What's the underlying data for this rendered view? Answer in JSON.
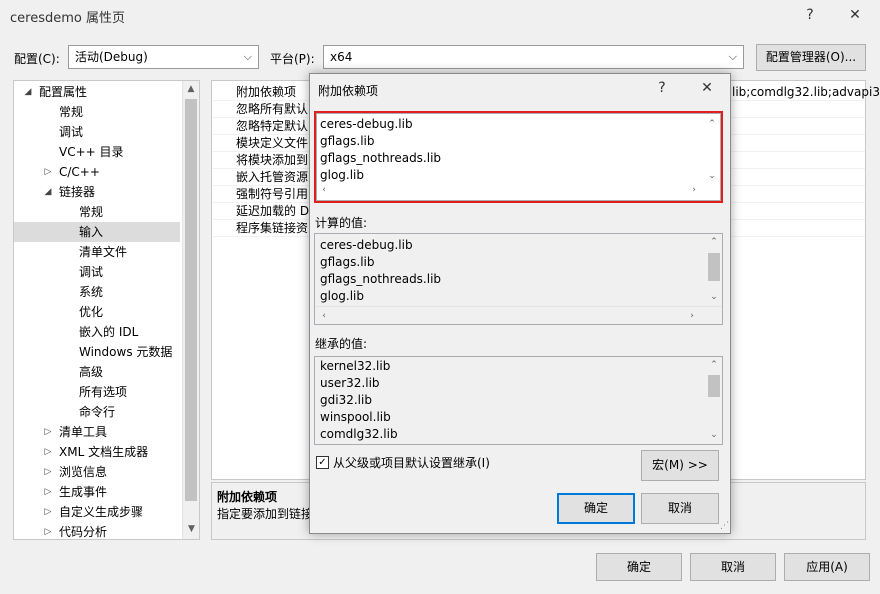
{
  "window": {
    "title": "ceresdemo 属性页",
    "help_glyph": "?",
    "close_glyph": "✕"
  },
  "toolbar": {
    "config_label": "配置(C):",
    "config_value": "活动(Debug)",
    "platform_label": "平台(P):",
    "platform_value": "x64",
    "config_manager_label": "配置管理器(O)..."
  },
  "tree": {
    "items": [
      {
        "label": "配置属性",
        "toggle": "◢"
      },
      {
        "label": "常规",
        "toggle": ""
      },
      {
        "label": "调试",
        "toggle": ""
      },
      {
        "label": "VC++ 目录",
        "toggle": ""
      },
      {
        "label": "C/C++",
        "toggle": "▷"
      },
      {
        "label": "链接器",
        "toggle": "◢"
      },
      {
        "label": "常规",
        "toggle": ""
      },
      {
        "label": "输入",
        "toggle": ""
      },
      {
        "label": "清单文件",
        "toggle": ""
      },
      {
        "label": "调试",
        "toggle": ""
      },
      {
        "label": "系统",
        "toggle": ""
      },
      {
        "label": "优化",
        "toggle": ""
      },
      {
        "label": "嵌入的 IDL",
        "toggle": ""
      },
      {
        "label": "Windows 元数据",
        "toggle": ""
      },
      {
        "label": "高级",
        "toggle": ""
      },
      {
        "label": "所有选项",
        "toggle": ""
      },
      {
        "label": "命令行",
        "toggle": ""
      },
      {
        "label": "清单工具",
        "toggle": "▷"
      },
      {
        "label": "XML 文档生成器",
        "toggle": "▷"
      },
      {
        "label": "浏览信息",
        "toggle": "▷"
      },
      {
        "label": "生成事件",
        "toggle": "▷"
      },
      {
        "label": "自定义生成步骤",
        "toggle": "▷"
      },
      {
        "label": "代码分析",
        "toggle": "▷"
      }
    ]
  },
  "grid": {
    "rows": [
      {
        "name": "附加依赖项",
        "value": "lib;comdlg32.lib;advapi3"
      },
      {
        "name": "忽略所有默认",
        "value": ""
      },
      {
        "name": "忽略特定默认",
        "value": ""
      },
      {
        "name": "模块定义文件",
        "value": ""
      },
      {
        "name": "将模块添加到",
        "value": ""
      },
      {
        "name": "嵌入托管资源",
        "value": ""
      },
      {
        "name": "强制符号引用",
        "value": ""
      },
      {
        "name": "延迟加载的 D",
        "value": ""
      },
      {
        "name": "程序集链接资",
        "value": ""
      }
    ],
    "desc_title": "附加依赖项",
    "desc_text": "指定要添加到链接"
  },
  "dialog": {
    "title": "附加依赖项",
    "help_glyph": "?",
    "close_glyph": "✕",
    "edit_lines": [
      "ceres-debug.lib",
      "gflags.lib",
      "gflags_nothreads.lib",
      "glog.lib"
    ],
    "computed_label": "计算的值:",
    "computed_lines": [
      "ceres-debug.lib",
      "gflags.lib",
      "gflags_nothreads.lib",
      "glog.lib"
    ],
    "inherited_label": "继承的值:",
    "inherited_lines": [
      "kernel32.lib",
      "user32.lib",
      "gdi32.lib",
      "winspool.lib",
      "comdlg32.lib"
    ],
    "inherit_checkbox_label": "从父级或项目默认设置继承(I)",
    "inherit_checked": true,
    "macro_label": "宏(M) >>",
    "ok_label": "确定",
    "cancel_label": "取消"
  },
  "footer": {
    "ok_label": "确定",
    "cancel_label": "取消",
    "apply_label": "应用(A)"
  },
  "colors": {
    "accent": "#0078d7",
    "highlight_frame": "#e0201c"
  }
}
